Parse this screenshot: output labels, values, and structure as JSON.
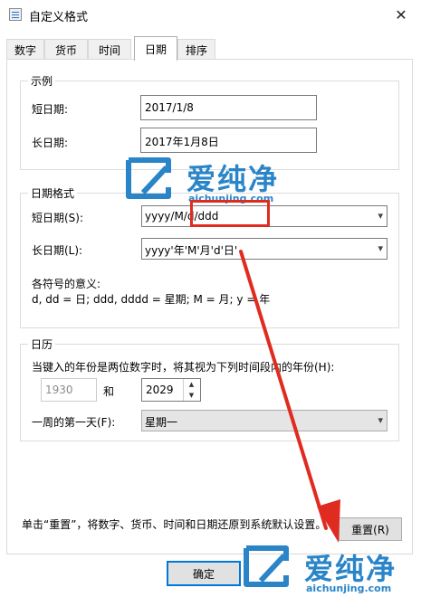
{
  "window": {
    "title": "自定义格式",
    "close_glyph": "✕"
  },
  "tabs": [
    {
      "label": "数字"
    },
    {
      "label": "货币"
    },
    {
      "label": "时间"
    },
    {
      "label": "日期",
      "active": true
    },
    {
      "label": "排序"
    }
  ],
  "example": {
    "legend": "示例",
    "short_label": "短日期:",
    "short_value": "2017/1/8",
    "long_label": "长日期:",
    "long_value": "2017年1月8日"
  },
  "date_format": {
    "legend": "日期格式",
    "short_label": "短日期(S):",
    "short_value": "yyyy/M/d/ddd",
    "long_label": "长日期(L):",
    "long_value": "yyyy'年'M'月'd'日'",
    "meaning_title": "各符号的意义:",
    "meaning_text": "d, dd = 日;  ddd, dddd = 星期;  M = 月;  y = 年"
  },
  "calendar": {
    "legend": "日历",
    "two_digit_text": "当键入的年份是两位数字时，将其视为下列时间段内的年份(H):",
    "year_from": "1930",
    "and_label": "和",
    "year_to": "2029",
    "first_day_label": "一周的第一天(F):",
    "first_day_value": "星期一"
  },
  "reset": {
    "text": "单击“重置”，将数字、货币、时间和日期还原到系统默认设置。",
    "button": "重置(R)"
  },
  "footer": {
    "ok_button": "确定"
  },
  "watermark": {
    "cn": "爱纯净",
    "url": "aichunjing.com"
  },
  "colors": {
    "accent": "#0078d7",
    "annotation": "#e02b20",
    "watermark": "#2a85c8"
  },
  "icons": {
    "dropdown": "▾",
    "spin_up": "▲",
    "spin_down": "▼"
  }
}
